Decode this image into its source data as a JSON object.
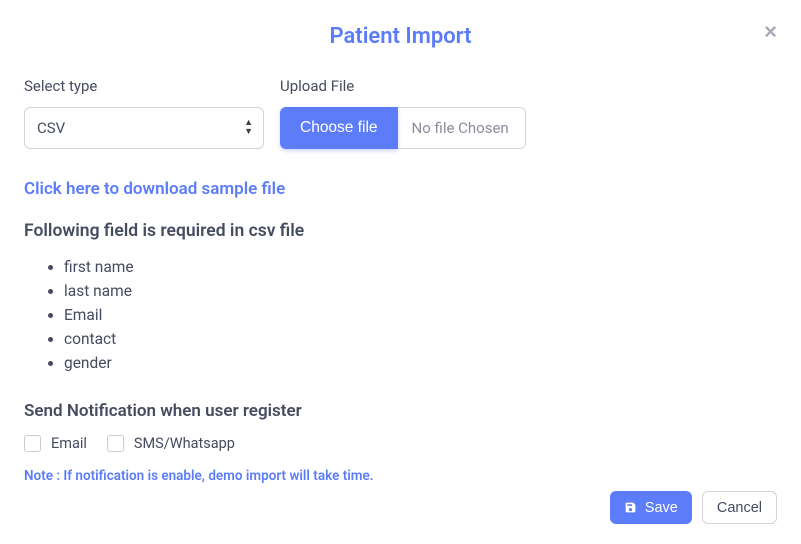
{
  "modal": {
    "title": "Patient Import"
  },
  "form": {
    "select_type_label": "Select type",
    "select_type_value": "CSV",
    "upload_label": "Upload File",
    "choose_file_label": "Choose file",
    "file_chosen_text": "No file Chosen"
  },
  "sample_link": "Click here to download sample file",
  "required_heading": "Following field is required in csv file",
  "required_fields": {
    "f0": "first name",
    "f1": "last name",
    "f2": "Email",
    "f3": "contact",
    "f4": "gender"
  },
  "notify_heading": "Send Notification when user register",
  "notify": {
    "email_label": "Email",
    "sms_label": "SMS/Whatsapp"
  },
  "note": "Note : If notification is enable, demo import will take time.",
  "footer": {
    "save": "Save",
    "cancel": "Cancel"
  }
}
